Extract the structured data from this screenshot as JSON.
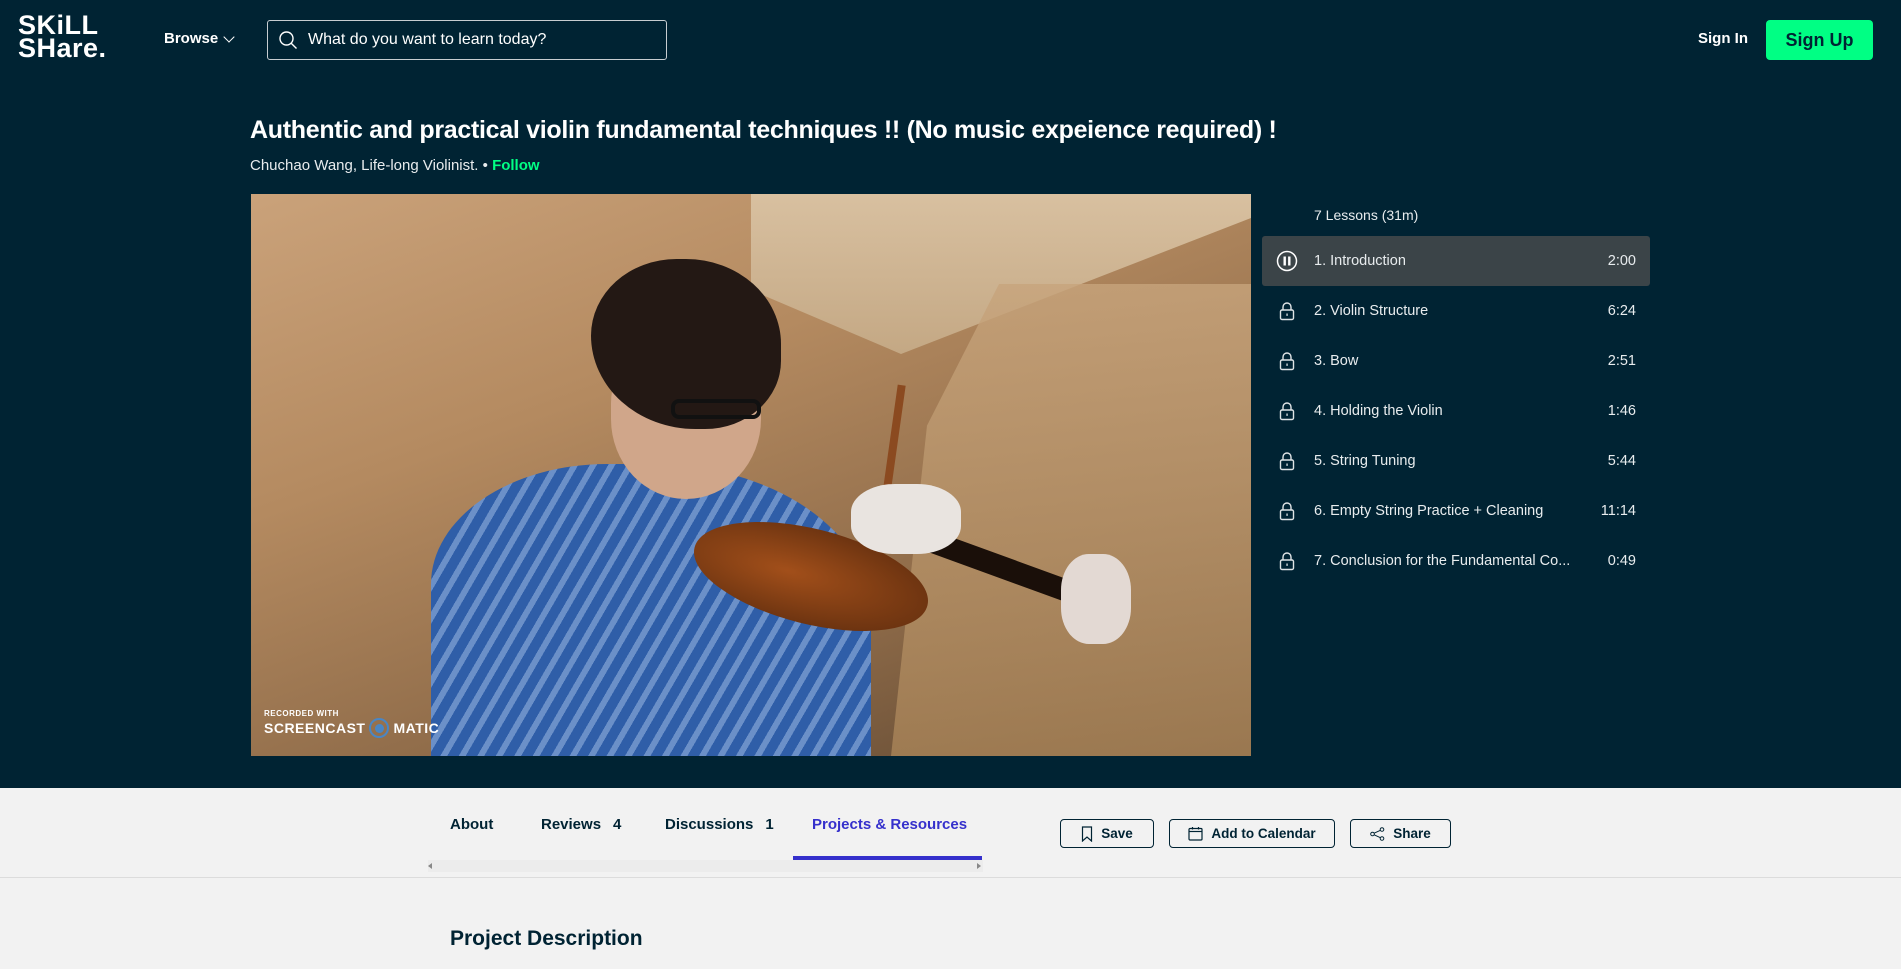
{
  "header": {
    "logo_line1": "SKiLL",
    "logo_line2": "SHare.",
    "browse_label": "Browse",
    "search_placeholder": "What do you want to learn today?",
    "signin_label": "Sign In",
    "signup_label": "Sign Up"
  },
  "course": {
    "title": "Authentic and practical violin fundamental techniques !! (No music expeience required) !",
    "author": "Chuchao Wang, Life-long Violinist.",
    "separator": " • ",
    "follow_label": "Follow"
  },
  "video": {
    "watermark_small": "RECORDED WITH",
    "watermark_left": "SCREENCAST",
    "watermark_right": "MATIC"
  },
  "lessons": {
    "summary": "7 Lessons (31m)",
    "items": [
      {
        "title": "1. Introduction",
        "duration": "2:00",
        "state": "playing"
      },
      {
        "title": "2. Violin Structure",
        "duration": "6:24",
        "state": "locked"
      },
      {
        "title": "3. Bow",
        "duration": "2:51",
        "state": "locked"
      },
      {
        "title": "4. Holding the Violin",
        "duration": "1:46",
        "state": "locked"
      },
      {
        "title": "5. String Tuning",
        "duration": "5:44",
        "state": "locked"
      },
      {
        "title": "6. Empty String Practice + Cleaning",
        "duration": "11:14",
        "state": "locked"
      },
      {
        "title": "7. Conclusion for the Fundamental Co...",
        "duration": "0:49",
        "state": "locked"
      }
    ]
  },
  "tabs": [
    {
      "label": "About",
      "count": ""
    },
    {
      "label": "Reviews",
      "count": "4"
    },
    {
      "label": "Discussions",
      "count": "1"
    },
    {
      "label": "Projects & Resources",
      "count": "",
      "active": true
    }
  ],
  "actions": {
    "save_label": "Save",
    "calendar_label": "Add to Calendar",
    "share_label": "Share"
  },
  "project": {
    "heading": "Project Description"
  },
  "colors": {
    "navy": "#002333",
    "accent_green": "#00ff84",
    "active_tab": "#3530cc"
  }
}
